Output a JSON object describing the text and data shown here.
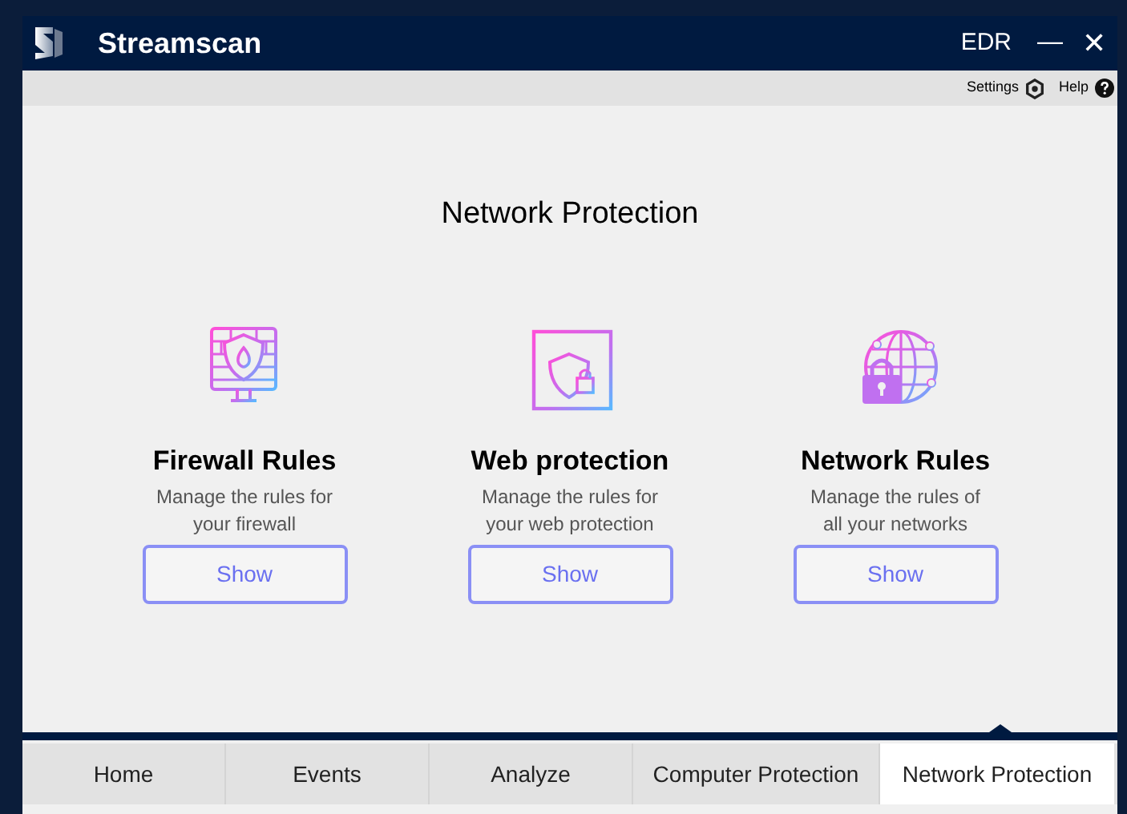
{
  "window": {
    "title": "Streamscan",
    "edition": "EDR",
    "minimize": "—",
    "close": "✕"
  },
  "toolbar": {
    "settings": "Settings",
    "help": "Help"
  },
  "page_title": "Network Protection",
  "cards": [
    {
      "kind": "firewall",
      "title": "Firewall Rules",
      "description": "Manage the rules for your firewall",
      "button": "Show"
    },
    {
      "kind": "web",
      "title": "Web protection",
      "description": "Manage the rules for your web protection",
      "button": "Show"
    },
    {
      "kind": "network",
      "title": "Network Rules",
      "description": "Manage the rules of all your networks",
      "button": "Show"
    }
  ],
  "tabs": [
    {
      "label": "Home",
      "selected": false
    },
    {
      "label": "Events",
      "selected": false
    },
    {
      "label": "Analyze",
      "selected": false
    },
    {
      "label": "Computer Protection",
      "selected": false
    },
    {
      "label": "Network Protection",
      "selected": true
    }
  ]
}
